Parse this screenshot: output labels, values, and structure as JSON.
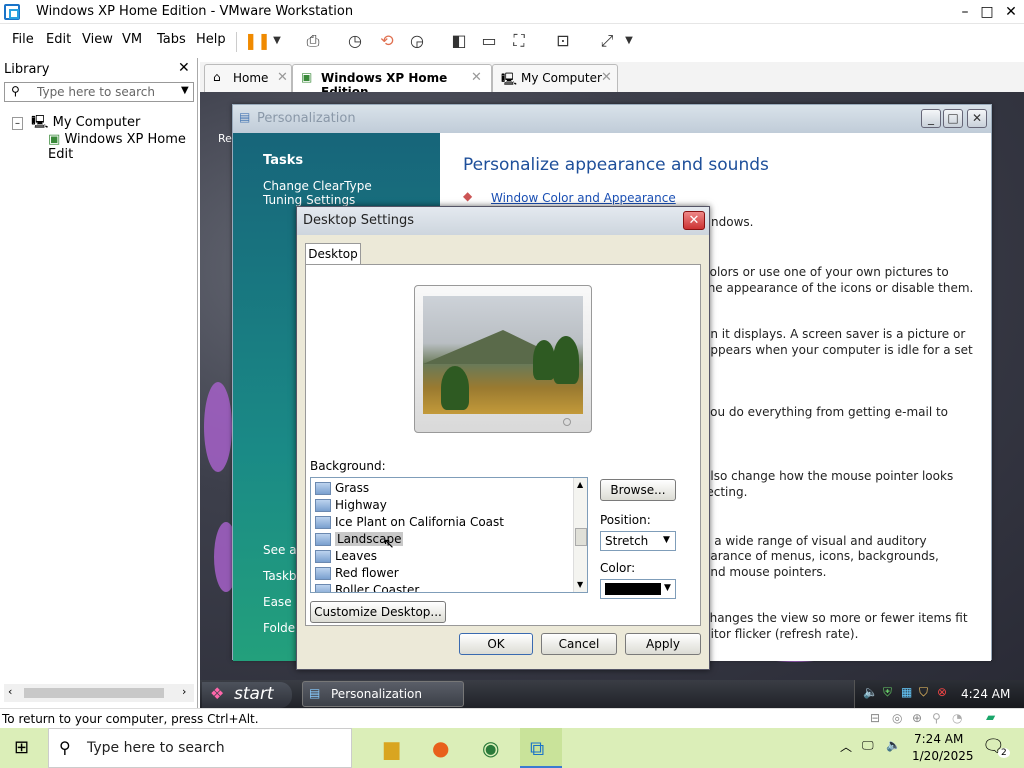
{
  "window": {
    "title": "Windows XP Home Edition - VMware Workstation",
    "min": "–",
    "max": "□",
    "close": "✕"
  },
  "menu": [
    "File",
    "Edit",
    "View",
    "VM",
    "Tabs",
    "Help"
  ],
  "library": {
    "title": "Library",
    "search_placeholder": "Type here to search",
    "tree": [
      {
        "label": "My Computer"
      },
      {
        "label": "Windows XP Home Edit"
      }
    ]
  },
  "tabs": [
    {
      "label": "Home"
    },
    {
      "label": "Windows XP Home Edition"
    },
    {
      "label": "My Computer"
    }
  ],
  "personalization": {
    "title": "Personalization",
    "tasks_heading": "Tasks",
    "task_link": "Change ClearType Tuning Settings",
    "see_also": [
      "See al",
      "Taskb",
      "Ease o",
      "Folder"
    ],
    "heading": "Personalize appearance and sounds",
    "first_link": "Window Color and Appearance",
    "texts": [
      "ndows.",
      "colors or use one of your own pictures to",
      "the appearance of the icons or disable them.",
      "en it displays. A screen saver is a picture or",
      "appears when your computer is idle for a set",
      "you do everything from getting e-mail to",
      "also change how the mouse pointer looks",
      "lecting.",
      "e a wide range of visual and auditory",
      "earance of menus, icons, backgrounds,",
      "and mouse pointers.",
      "changes the view so more or fewer items fit",
      "nitor flicker (refresh rate)."
    ]
  },
  "dialog": {
    "title": "Desktop Settings",
    "tab": "Desktop",
    "background_label": "Background:",
    "items": [
      "Grass",
      "Highway",
      "Ice Plant on California Coast",
      "Landscape",
      "Leaves",
      "Red flower",
      "Roller Coaster"
    ],
    "selected": "Landscape",
    "browse": "Browse...",
    "position_label": "Position:",
    "position_value": "Stretch",
    "color_label": "Color:",
    "color_value": "#000000",
    "customize": "Customize Desktop...",
    "ok": "OK",
    "cancel": "Cancel",
    "apply": "Apply"
  },
  "xp_taskbar": {
    "start": "start",
    "task": "Personalization",
    "time": "4:24 AM"
  },
  "guest_desktop_label": "Re",
  "status": "To return to your computer, press Ctrl+Alt.",
  "win_taskbar": {
    "search_placeholder": "Type here to search",
    "time": "7:24 AM",
    "date": "1/20/2025",
    "notif_count": "2"
  }
}
